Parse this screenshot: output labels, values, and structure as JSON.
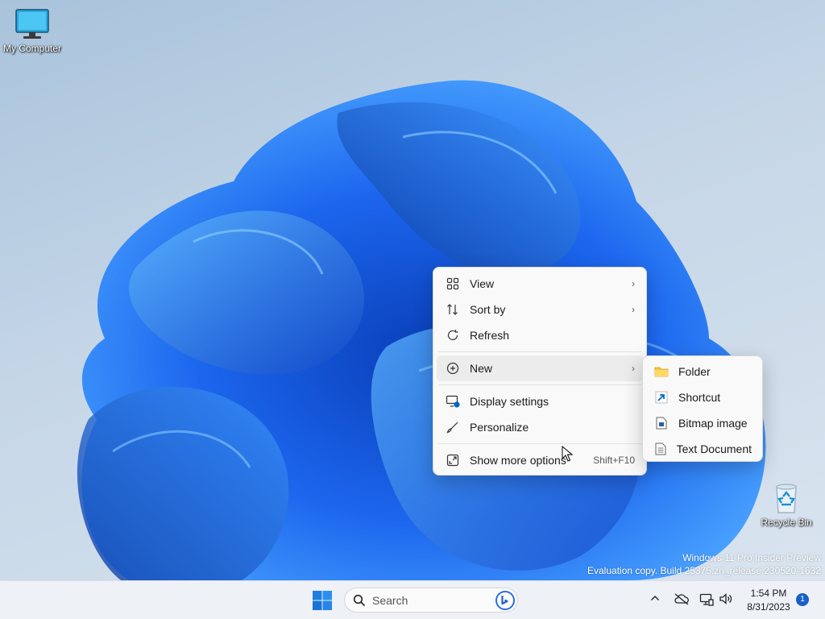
{
  "desktop": {
    "icons": [
      {
        "label": "My Computer",
        "icon": "monitor-icon"
      },
      {
        "label": "Recycle Bin",
        "icon": "recycle-bin-icon"
      }
    ],
    "watermark": {
      "line1": "Windows 11 Pro Insider Preview",
      "line2": "Evaluation copy. Build 25375.zn_release.230520-1632"
    }
  },
  "context_menu": {
    "items": [
      {
        "label": "View",
        "icon": "grid-icon",
        "has_submenu": true
      },
      {
        "label": "Sort by",
        "icon": "sort-icon",
        "has_submenu": true
      },
      {
        "label": "Refresh",
        "icon": "refresh-icon"
      },
      {
        "label": "New",
        "icon": "plus-circle-icon",
        "has_submenu": true,
        "highlighted": true
      },
      {
        "label": "Display settings",
        "icon": "display-settings-icon"
      },
      {
        "label": "Personalize",
        "icon": "brush-icon"
      },
      {
        "label": "Show more options",
        "icon": "expand-icon",
        "accelerator": "Shift+F10"
      }
    ],
    "chevron": "›"
  },
  "submenu_new": {
    "items": [
      {
        "label": "Folder",
        "icon": "folder-icon"
      },
      {
        "label": "Shortcut",
        "icon": "shortcut-icon"
      },
      {
        "label": "Bitmap image",
        "icon": "bitmap-icon"
      },
      {
        "label": "Text Document",
        "icon": "text-document-icon"
      }
    ]
  },
  "taskbar": {
    "search_placeholder": "Search",
    "clock": {
      "time": "1:54 PM",
      "date": "8/31/2023"
    },
    "notification_count": "1"
  },
  "colors": {
    "accent": "#0067c0",
    "bloom": "#1f6cf0",
    "folder": "#f4c542"
  }
}
